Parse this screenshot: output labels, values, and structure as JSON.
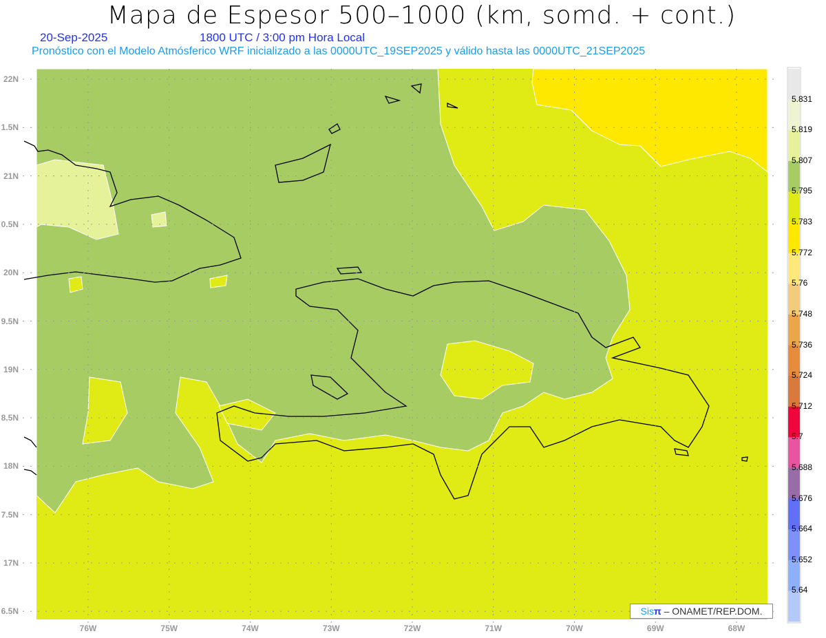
{
  "header": {
    "title": "Mapa de Espesor 500–1000 (km, somd. + cont.)",
    "date": "20-Sep-2025",
    "time": "1800 UTC / 3:00 pm Hora Local",
    "forecast": "Pronóstico con el Modelo Atmósferico WRF inicializado a las 0000UTC_19SEP2025 y válido hasta las  0000UTC_21SEP2025"
  },
  "axes": {
    "lat_labels": [
      "22N",
      "1.5N",
      "21N",
      "0.5N",
      "20N",
      "9.5N",
      "19N",
      "8.5N",
      "18N",
      "7.5N",
      "17N",
      "6.5N"
    ],
    "lon_labels": [
      "76W",
      "75W",
      "74W",
      "73W",
      "72W",
      "71W",
      "70W",
      "69W",
      "68W"
    ]
  },
  "colorbar": {
    "colors": [
      "#e8e8e8",
      "#eef3d2",
      "#e6f29a",
      "#a8cc64",
      "#e0ea14",
      "#ffe800",
      "#ffe87a",
      "#f2cc7a",
      "#eca64a",
      "#e68c3c",
      "#d87a3c",
      "#f0063c",
      "#e854a0",
      "#9a6ca6",
      "#6270f6",
      "#7e90fa",
      "#8eb0fa",
      "#b4c8fa"
    ],
    "labels": [
      "5.831",
      "5.819",
      "5.807",
      "5.795",
      "5.783",
      "5.772",
      "5.76",
      "5.748",
      "5.736",
      "5.724",
      "5.712",
      "5.7",
      "5.688",
      "5.676",
      "5.664",
      "5.652",
      "5.64"
    ]
  },
  "fill_colors": {
    "green": "#a8cc64",
    "yellowgreen": "#e0ea14",
    "yellow": "#ffe800",
    "light": "#e6f29a"
  },
  "credit": {
    "sis": "Sis",
    "pi": "π",
    "rest": "– ONAMET/REP.DOM."
  }
}
